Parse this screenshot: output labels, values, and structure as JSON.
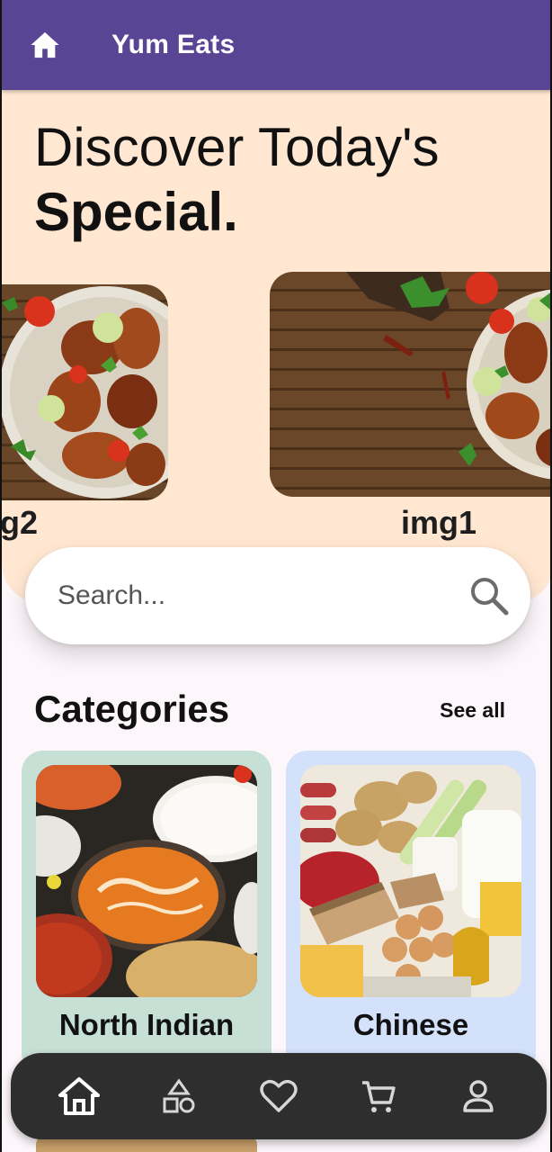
{
  "app_bar": {
    "title": "Yum Eats",
    "icon": "home-icon"
  },
  "hero": {
    "title_line1": "Discover Today's",
    "title_line2": "Special.",
    "carousel": [
      {
        "label": "g2"
      },
      {
        "label": "img1"
      }
    ]
  },
  "search": {
    "placeholder": "Search...",
    "icon": "search-icon"
  },
  "categories": {
    "heading": "Categories",
    "see_all": "See all",
    "items": [
      {
        "label": "North Indian",
        "bg": "#c7e0d6"
      },
      {
        "label": "Chinese",
        "bg": "#d3e1fb"
      }
    ]
  },
  "bottom_nav": {
    "items": [
      "home-icon",
      "categories-icon",
      "favorites-icon",
      "cart-icon",
      "profile-icon"
    ],
    "active": "home-icon"
  },
  "colors": {
    "app_bar": "#5a4594",
    "hero_bg": "#ffe7d2",
    "page_bg": "#fdf7fb",
    "nav_bg": "#2e2e2e"
  }
}
